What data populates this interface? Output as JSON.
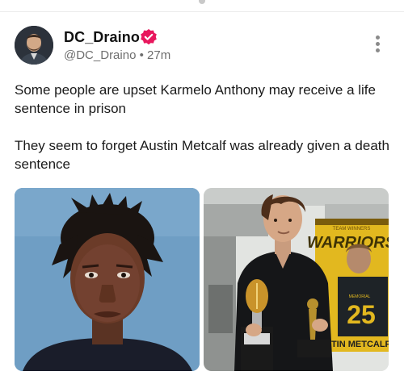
{
  "post": {
    "author_name": "DC_Draino",
    "handle": "@DC_Draino",
    "separator": "•",
    "timestamp": "27m",
    "paragraphs": [
      "Some people are upset Karmelo Anthony may receive a life sentence in prison",
      "They seem to forget Austin Metcalf was already given a death sentence"
    ]
  },
  "media_right": {
    "banner_team_small": "TEAM WINNERS",
    "banner_team": "WARRIORS",
    "jersey_number": "25",
    "jersey_team": "MEMORIAL",
    "caption": "AUSTIN METCALF"
  },
  "colors": {
    "verified_badge": "#e8175d",
    "banner_gold": "#e2b81f",
    "photo_bg_left": "#6e9dc3"
  },
  "icons": {
    "verified": "verified-badge-icon",
    "more": "more-vertical-icon"
  }
}
